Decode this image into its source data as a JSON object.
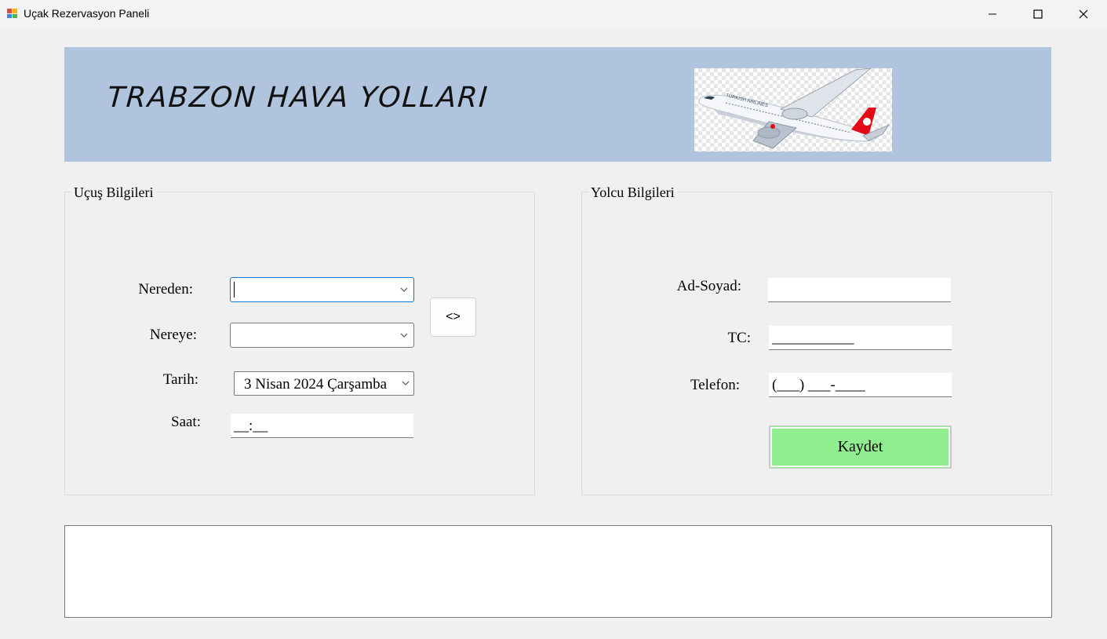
{
  "window": {
    "title": "Uçak Rezervasyon Paneli"
  },
  "banner": {
    "title": "TRABZON HAVA YOLLARI",
    "background": "#b0c4de"
  },
  "flight": {
    "legend": "Uçuş Bilgileri",
    "from_label": "Nereden:",
    "from_value": "",
    "to_label": "Nereye:",
    "to_value": "",
    "swap_label": "<>",
    "date_label": "Tarih:",
    "date_value": "3   Nisan   2024 Çarşamba",
    "time_label": "Saat:",
    "time_value": "__:__"
  },
  "passenger": {
    "legend": "Yolcu Bilgileri",
    "name_label": "Ad-Soyad:",
    "name_value": "",
    "tc_label": "TC:",
    "tc_value": "___________",
    "phone_label": "Telefon:",
    "phone_value": "(___) ___-____",
    "save_label": "Kaydet",
    "save_color": "#90ee90"
  },
  "output": {
    "text": ""
  }
}
